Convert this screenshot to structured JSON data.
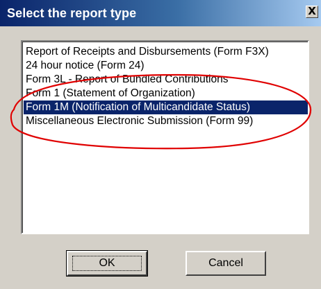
{
  "dialog": {
    "title": "Select the report type",
    "close_glyph": "X",
    "close_icon": "close-icon"
  },
  "list": {
    "items": [
      {
        "label": "Report of Receipts and Disbursements (Form F3X)",
        "selected": false
      },
      {
        "label": "24 hour notice (Form 24)",
        "selected": false
      },
      {
        "label": "Form 3L - Report of Bundled Contributions",
        "selected": false
      },
      {
        "label": "Form 1 (Statement of Organization)",
        "selected": false
      },
      {
        "label": "Form 1M (Notification of Multicandidate Status)",
        "selected": true
      },
      {
        "label": "Miscellaneous Electronic Submission (Form 99)",
        "selected": false
      }
    ],
    "selection_color": "#0a246a"
  },
  "annotation": {
    "color": "#e00000"
  },
  "buttons": {
    "ok_label": "OK",
    "cancel_label": "Cancel"
  }
}
